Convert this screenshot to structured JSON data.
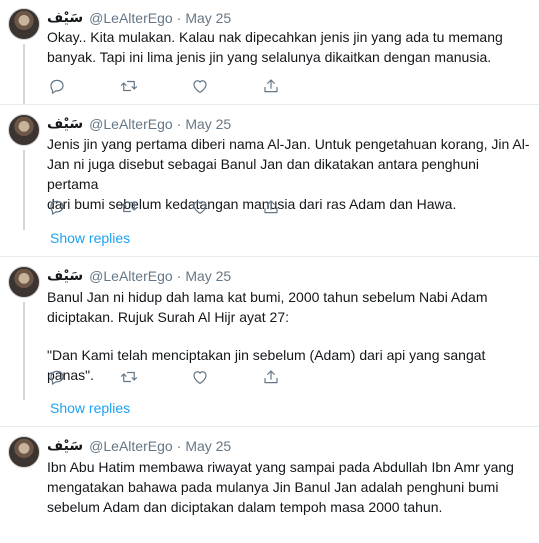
{
  "tweets": [
    {
      "name": "ﺳَﯿْﻒ",
      "handle": "@LeAlterEgo",
      "sep": "·",
      "date": "May 25",
      "lines": [
        "Okay.. Kita mulakan. Kalau nak dipecahkan jenis jin yang ada tu memang",
        "banyak. Tapi ini lima jenis jin yang selalunya dikaitkan dengan manusia."
      ]
    },
    {
      "name": "ﺳَﯿْﻒ",
      "handle": "@LeAlterEgo",
      "sep": "·",
      "date": "May 25",
      "lines": [
        "Jenis jin yang pertama diberi nama Al-Jan. Untuk pengetahuan korang, Jin Al-",
        "Jan ni juga disebut sebagai Banul Jan dan dikatakan antara penghuni pertama",
        "dari bumi sebelum kedatangan manusia dari ras Adam dan Hawa."
      ]
    },
    {
      "name": "ﺳَﯿْﻒ",
      "handle": "@LeAlterEgo",
      "sep": "·",
      "date": "May 25",
      "lines": [
        "Banul Jan ni hidup dah lama kat bumi, 2000 tahun sebelum Nabi Adam",
        "diciptakan. Rujuk Surah Al Hijr ayat 27:",
        "",
        "\"Dan Kami telah menciptakan jin sebelum (Adam) dari api yang sangat panas\"."
      ]
    },
    {
      "name": "ﺳَﯿْﻒ",
      "handle": "@LeAlterEgo",
      "sep": "·",
      "date": "May 25",
      "lines": [
        "Ibn Abu Hatim membawa riwayat yang sampai pada Abdullah Ibn Amr yang",
        "mengatakan bahawa pada mulanya Jin Banul Jan adalah penghuni bumi",
        "sebelum Adam dan diciptakan dalam tempoh masa 2000 tahun."
      ]
    }
  ],
  "show_replies": [
    "Show replies",
    "Show replies"
  ],
  "icons": {
    "reply": "reply-icon",
    "retweet": "retweet-icon",
    "like": "like-icon",
    "share": "share-icon"
  },
  "colors": {
    "link": "#1da1f2",
    "muted": "#657786",
    "text": "#14171a",
    "divider": "#e6ecf0"
  }
}
